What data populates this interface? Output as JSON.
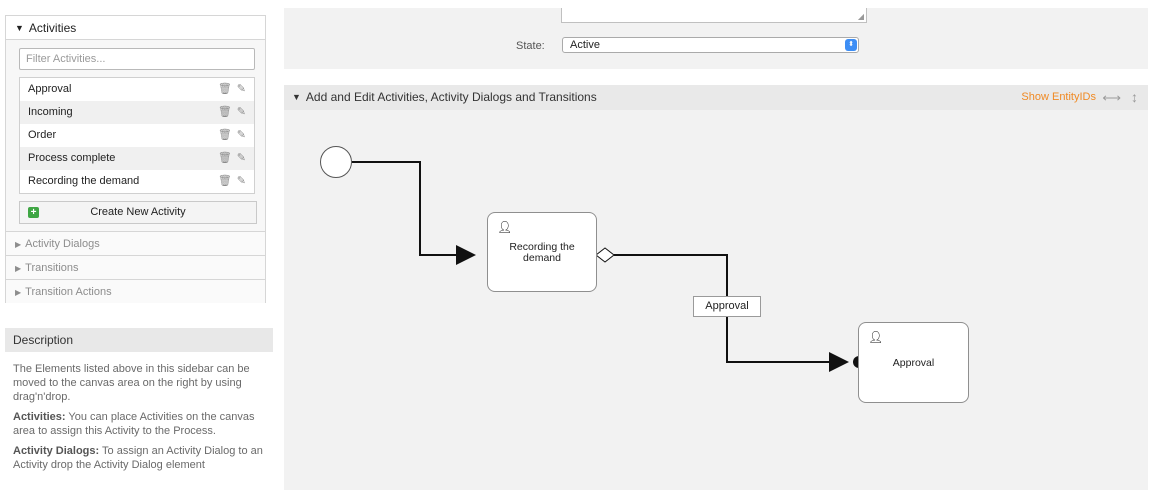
{
  "sidebar": {
    "activities_title": "Activities",
    "filter_placeholder": "Filter Activities...",
    "activities": [
      {
        "label": "Approval"
      },
      {
        "label": "Incoming"
      },
      {
        "label": "Order"
      },
      {
        "label": "Process complete"
      },
      {
        "label": "Recording the demand"
      }
    ],
    "create_button_label": "Create New Activity",
    "sections": [
      "Activity Dialogs",
      "Transitions",
      "Transition Actions"
    ]
  },
  "description": {
    "title": "Description",
    "intro": "The Elements listed above in this sidebar can be moved to the canvas area on the right by using drag'n'drop.",
    "activities_term": "Activities:",
    "activities_text": " You can place Activities on the canvas area to assign this Activity to the Process.",
    "dialogs_term": "Activity Dialogs:",
    "dialogs_text": " To assign an Activity Dialog to an Activity drop the Activity Dialog element"
  },
  "form": {
    "state_label": "State:",
    "state_value": "Active"
  },
  "canvas_panel": {
    "title": "Add and Edit Activities, Activity Dialogs and Transitions",
    "show_entity_ids": "Show EntityIDs",
    "nodes": {
      "recording": "Recording the demand",
      "approval": "Approval"
    },
    "transition_label": "Approval"
  },
  "icons": {
    "trash": "trash-icon",
    "edit": "edit-icon",
    "user": "user-icon",
    "collapse": "triangle-down-icon",
    "expand": "triangle-right-icon",
    "plus": "plus-icon",
    "resize_h": "resize-horizontal-icon",
    "resize_v": "resize-vertical-icon"
  },
  "colors": {
    "accent_orange": "#f08a24",
    "plus_green": "#3fa644",
    "select_blue": "#3d8ef5"
  }
}
